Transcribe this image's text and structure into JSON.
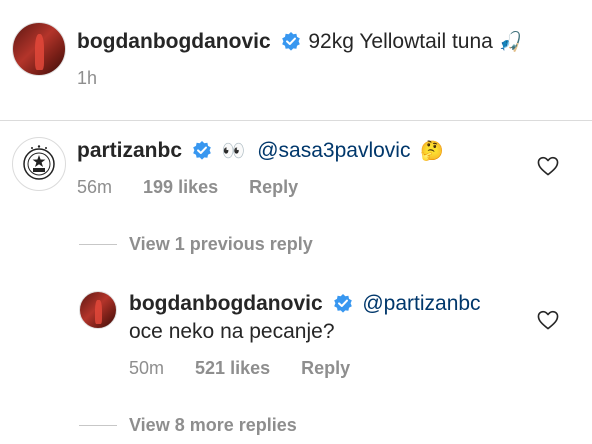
{
  "caption": {
    "username": "bogdanbogdanovic",
    "text": "92kg Yellowtail tuna",
    "emoji": "🎣",
    "time": "1h"
  },
  "comment1": {
    "username": "partizanbc",
    "emoji_prefix": "👀",
    "mention": "@sasa3pavlovic",
    "emoji_suffix": "🤔",
    "time": "56m",
    "likes": "199 likes",
    "reply_label": "Reply",
    "view_previous": "View 1 previous reply"
  },
  "reply1": {
    "username": "bogdanbogdanovic",
    "mention": "@partizanbc",
    "text": "oce neko na pecanje?",
    "time": "50m",
    "likes": "521 likes",
    "reply_label": "Reply",
    "view_more": "View 8 more replies"
  },
  "colors": {
    "verified": "#3897f0",
    "mention": "#00376b",
    "meta": "#8e8e8e"
  }
}
